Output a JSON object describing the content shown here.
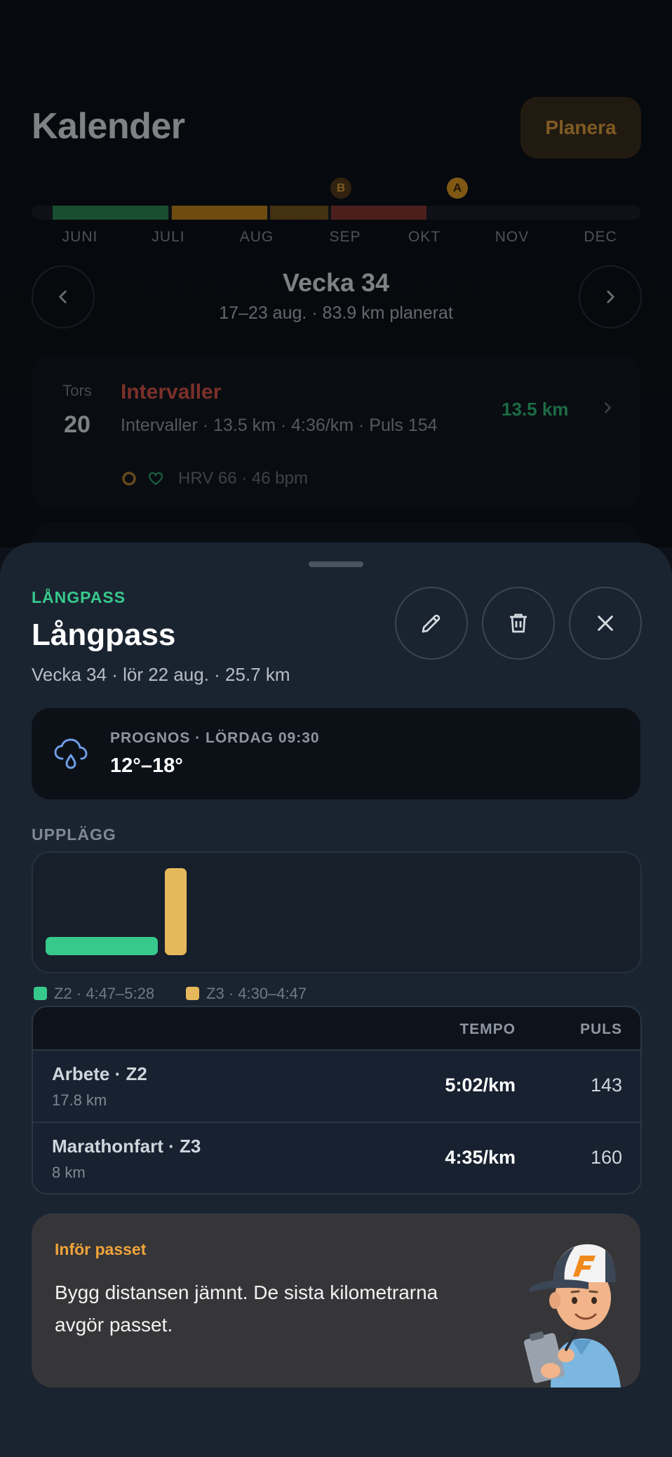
{
  "header": {
    "title": "Kalender",
    "plan_button": "Planera"
  },
  "season": {
    "months": [
      "JUNI",
      "JULI",
      "AUG",
      "SEP",
      "OKT",
      "NOV",
      "DEC"
    ],
    "race_markers": [
      {
        "label": "B",
        "color": "#b4701a"
      },
      {
        "label": "A",
        "color": "#e8a025"
      }
    ],
    "phase_colors": [
      "#2f8f5a",
      "#c98a1f",
      "#7a5a22",
      "#8a3a36"
    ]
  },
  "week": {
    "title": "Vecka 34",
    "subtitle": "17–23 aug. · 83.9 km planerat"
  },
  "day": {
    "weekday": "Tors",
    "date": "20",
    "workout_name": "Intervaller",
    "workout_details": "Intervaller · 13.5 km · 4:36/km · Puls 154",
    "distance": "13.5 km",
    "hrv": "HRV 66 · 46 bpm",
    "colors": {
      "name": "#e0584c",
      "distance": "#34c47c"
    }
  },
  "sheet": {
    "category": "LÅNGPASS",
    "title": "Långpass",
    "subtitle": "Vecka 34 · lör 22 aug. · 25.7 km",
    "accent": "#37c98c"
  },
  "weather": {
    "label": "PROGNOS · LÖRDAG 09:30",
    "temp": "12°–18°"
  },
  "plan": {
    "section_label": "UPPLÄGG",
    "legend": [
      {
        "text": "Z2 · 4:47–5:28",
        "color": "#37c98c"
      },
      {
        "text": "Z3 · 4:30–4:47",
        "color": "#e6b85c"
      }
    ],
    "table": {
      "headers": {
        "tempo": "TEMPO",
        "puls": "PULS"
      },
      "rows": [
        {
          "name": "Arbete · Z2",
          "distance": "17.8 km",
          "tempo": "5:02/km",
          "puls": "143"
        },
        {
          "name": "Marathonfart · Z3",
          "distance": "8 km",
          "tempo": "4:35/km",
          "puls": "160"
        }
      ]
    }
  },
  "tip": {
    "title": "Inför passet",
    "text_line1": "Bygg distansen jämnt. De sista kilometrarna",
    "text_line2": "avgör passet.",
    "title_color": "#f0a33a"
  }
}
